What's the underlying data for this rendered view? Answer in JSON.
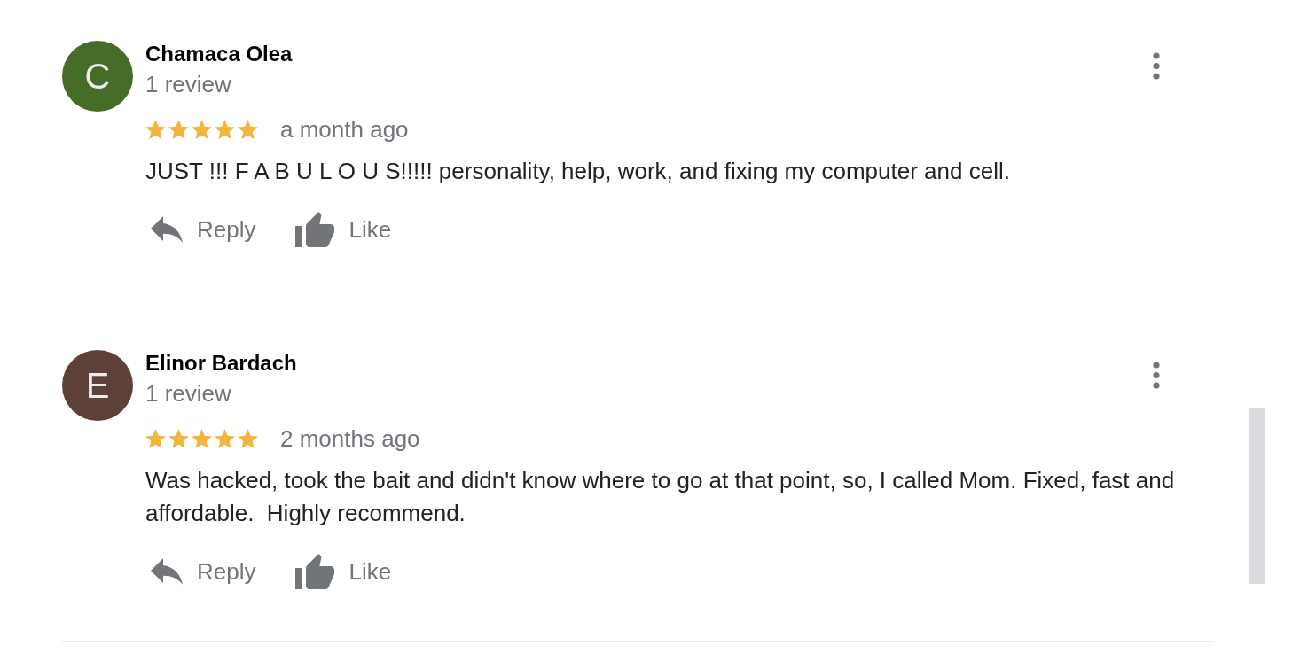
{
  "reviews": [
    {
      "avatar": {
        "initial": "C",
        "color": "#466d27"
      },
      "name": "Chamaca Olea",
      "review_count": "1 review",
      "stars": 5,
      "time": "a month ago",
      "text": "JUST !!! F A B U L O U S!!!!! personality, help, work, and fixing my computer and cell.",
      "actions": [
        {
          "kind": "reply",
          "label": "Reply"
        },
        {
          "kind": "like",
          "label": "Like"
        }
      ]
    },
    {
      "avatar": {
        "initial": "E",
        "color": "#5d4037"
      },
      "name": "Elinor Bardach",
      "review_count": "1 review",
      "stars": 5,
      "time": "2 months ago",
      "text": "Was hacked, took the bait and didn't know where to go at that point, so, I called Mom. Fixed, fast and affordable.  Highly recommend.",
      "actions": [
        {
          "kind": "reply",
          "label": "Reply"
        },
        {
          "kind": "like",
          "label": "Like"
        }
      ]
    }
  ]
}
